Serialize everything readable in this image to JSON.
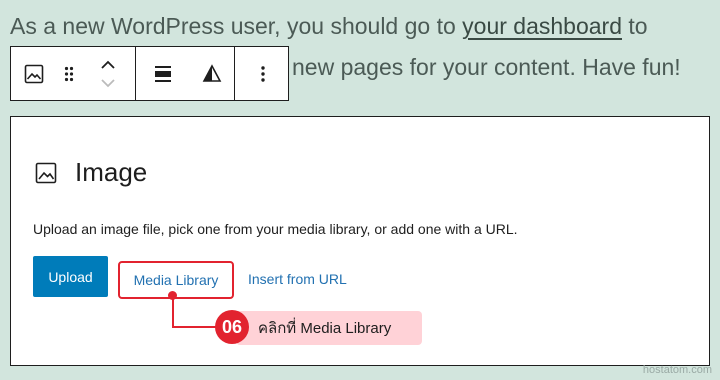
{
  "paragraph": {
    "line1_before": "As a new WordPress user, you should go to ",
    "line1_link": "your dashboard",
    "line1_after": " to",
    "line2": "new pages for your content. Have fun!"
  },
  "toolbar": {
    "icons": [
      "image-icon",
      "drag-handle-icon",
      "chevron-up-icon",
      "chevron-down-icon",
      "align-icon",
      "contrast-icon",
      "more-options-icon"
    ]
  },
  "image_block": {
    "title": "Image",
    "instructions": "Upload an image file, pick one from your media library, or add one with a URL.",
    "upload_label": "Upload",
    "media_library_label": "Media Library",
    "insert_url_label": "Insert from URL"
  },
  "callout": {
    "step": "06",
    "text": "คลิกที่ Media Library"
  },
  "watermark": "hostatom.com",
  "colors": {
    "background": "#d2e5dd",
    "primary": "#007cba",
    "link": "#2271b1",
    "highlight": "#e2232f",
    "callout_bg": "#ffd2d7"
  }
}
